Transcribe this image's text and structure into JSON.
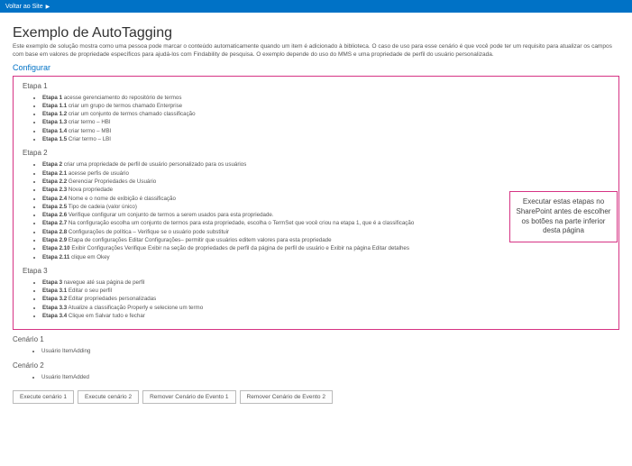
{
  "topbar": {
    "back_label": "Voltar ao Site"
  },
  "header": {
    "title": "Exemplo de AutoTagging",
    "description": "Este exemplo de solução mostra como uma pessoa pode marcar o conteúdo automaticamente quando um item é adicionado à biblioteca. O caso de uso para esse cenário é que você pode ter um requisito para atualizar os campos com base em valores de propriedade específicos para ajudá-los com Findability de pesquisa. O exemplo depende do uso do MMS e uma propriedade de perfil do usuário personalizada.",
    "configure": "Configurar"
  },
  "callout": "Executar estas etapas no SharePoint antes de escolher os botões na parte inferior desta página",
  "stage1": {
    "title": "Etapa 1",
    "items": [
      {
        "b": "Etapa 1",
        "t": " acesse gerenciamento do repositório de termos"
      },
      {
        "b": "Etapa 1.1",
        "t": " criar um grupo de termos chamado Enterprise"
      },
      {
        "b": "Etapa 1.2",
        "t": " criar um conjunto de termos chamado classificação"
      },
      {
        "b": "Etapa 1.3",
        "t": " criar termo – HBI"
      },
      {
        "b": "Etapa 1.4",
        "t": " criar termo – MBI"
      },
      {
        "b": "Etapa 1.5",
        "t": " Criar termo – LBI"
      }
    ]
  },
  "stage2": {
    "title": "Etapa 2",
    "items": [
      {
        "b": "Etapa 2",
        "t": " criar uma propriedade de perfil de usuário personalizado para os usuários"
      },
      {
        "b": "Etapa 2.1",
        "t": " acesse perfis de usuário"
      },
      {
        "b": "Etapa 2.2",
        "t": " Gerenciar Propriedades de Usuário"
      },
      {
        "b": "Etapa 2.3",
        "t": " Nova propriedade"
      },
      {
        "b": "Etapa 2.4",
        "t": " Nome e o nome de exibição é classificação"
      },
      {
        "b": "Etapa 2.5",
        "t": " Tipo de cadeia (valor único)"
      },
      {
        "b": "Etapa 2.6",
        "t": " Verifique configurar um conjunto de termos a serem usados para esta propriedade."
      },
      {
        "b": "Etapa 2.7",
        "t": " Na configuração escolha um conjunto de termos para esta propriedade, escolha o TermSet que você criou na etapa 1, que é a classificação"
      },
      {
        "b": "Etapa 2.8",
        "t": " Configurações de política – Verifique se o usuário pode substituir"
      },
      {
        "b": "Etapa 2.9",
        "t": " Etapa de configurações Editar Configurações– permitir que usuários editem valores para esta propriedade"
      },
      {
        "b": "Etapa 2.10",
        "t": " Exibir Configurações Verifique Exibir na seção de propriedades de perfil da página de perfil de usuário e Exibir na página Editar detalhes"
      },
      {
        "b": "Etapa 2.11",
        "t": " clique em Okey"
      }
    ]
  },
  "stage3": {
    "title": "Etapa 3",
    "items": [
      {
        "b": "Etapa 3",
        "t": " navegue até sua página de perfil"
      },
      {
        "b": "Etapa 3.1",
        "t": " Editar o seu perfil"
      },
      {
        "b": "Etapa 3.2",
        "t": " Editar propriedades personalizadas"
      },
      {
        "b": "Etapa 3.3",
        "t": " Atualize a classificação Properly e selecione um termo"
      },
      {
        "b": "Etapa 3.4",
        "t": " Clique em Salvar tudo e fechar"
      }
    ]
  },
  "scenario1": {
    "title": "Cenário 1",
    "item": "Usuário ItemAdding"
  },
  "scenario2": {
    "title": "Cenário 2",
    "item": "Usuário ItemAdded"
  },
  "buttons": {
    "exec1": "Execute cenário 1",
    "exec2": "Execute cenário 2",
    "rem1": "Remover Cenário de Evento 1",
    "rem2": "Remover Cenário de Evento 2"
  }
}
